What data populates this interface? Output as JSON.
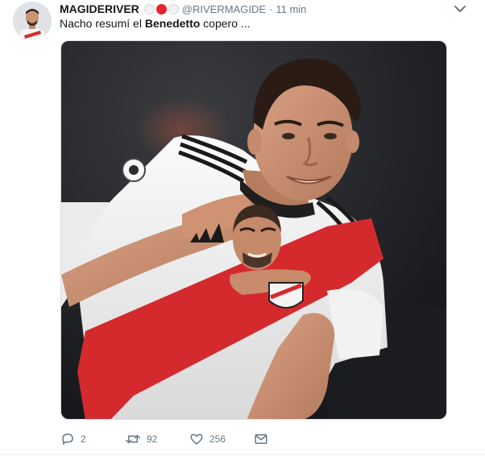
{
  "tweet": {
    "display_name": "MAGIDERIVER",
    "handle": "@RIVERMAGIDE",
    "separator": "·",
    "time": "11 min",
    "text_part1": "Nacho resumí el ",
    "text_bold": "Benedetto",
    "text_part2": " copero ...",
    "badge_colors": [
      "#f1f1f1",
      "#e0262c",
      "#f1f1f1"
    ],
    "actions": {
      "reply_count": "2",
      "retweet_count": "92",
      "like_count": "256"
    },
    "icons": {
      "reply": "reply-icon",
      "retweet": "retweet-icon",
      "like": "heart-icon",
      "dm": "envelope-icon",
      "menu": "chevron-down-icon"
    },
    "colors": {
      "jersey_red": "#d42a2d",
      "jersey_white": "#f4f4f4",
      "text_primary": "#14171a",
      "text_secondary": "#657786"
    }
  }
}
